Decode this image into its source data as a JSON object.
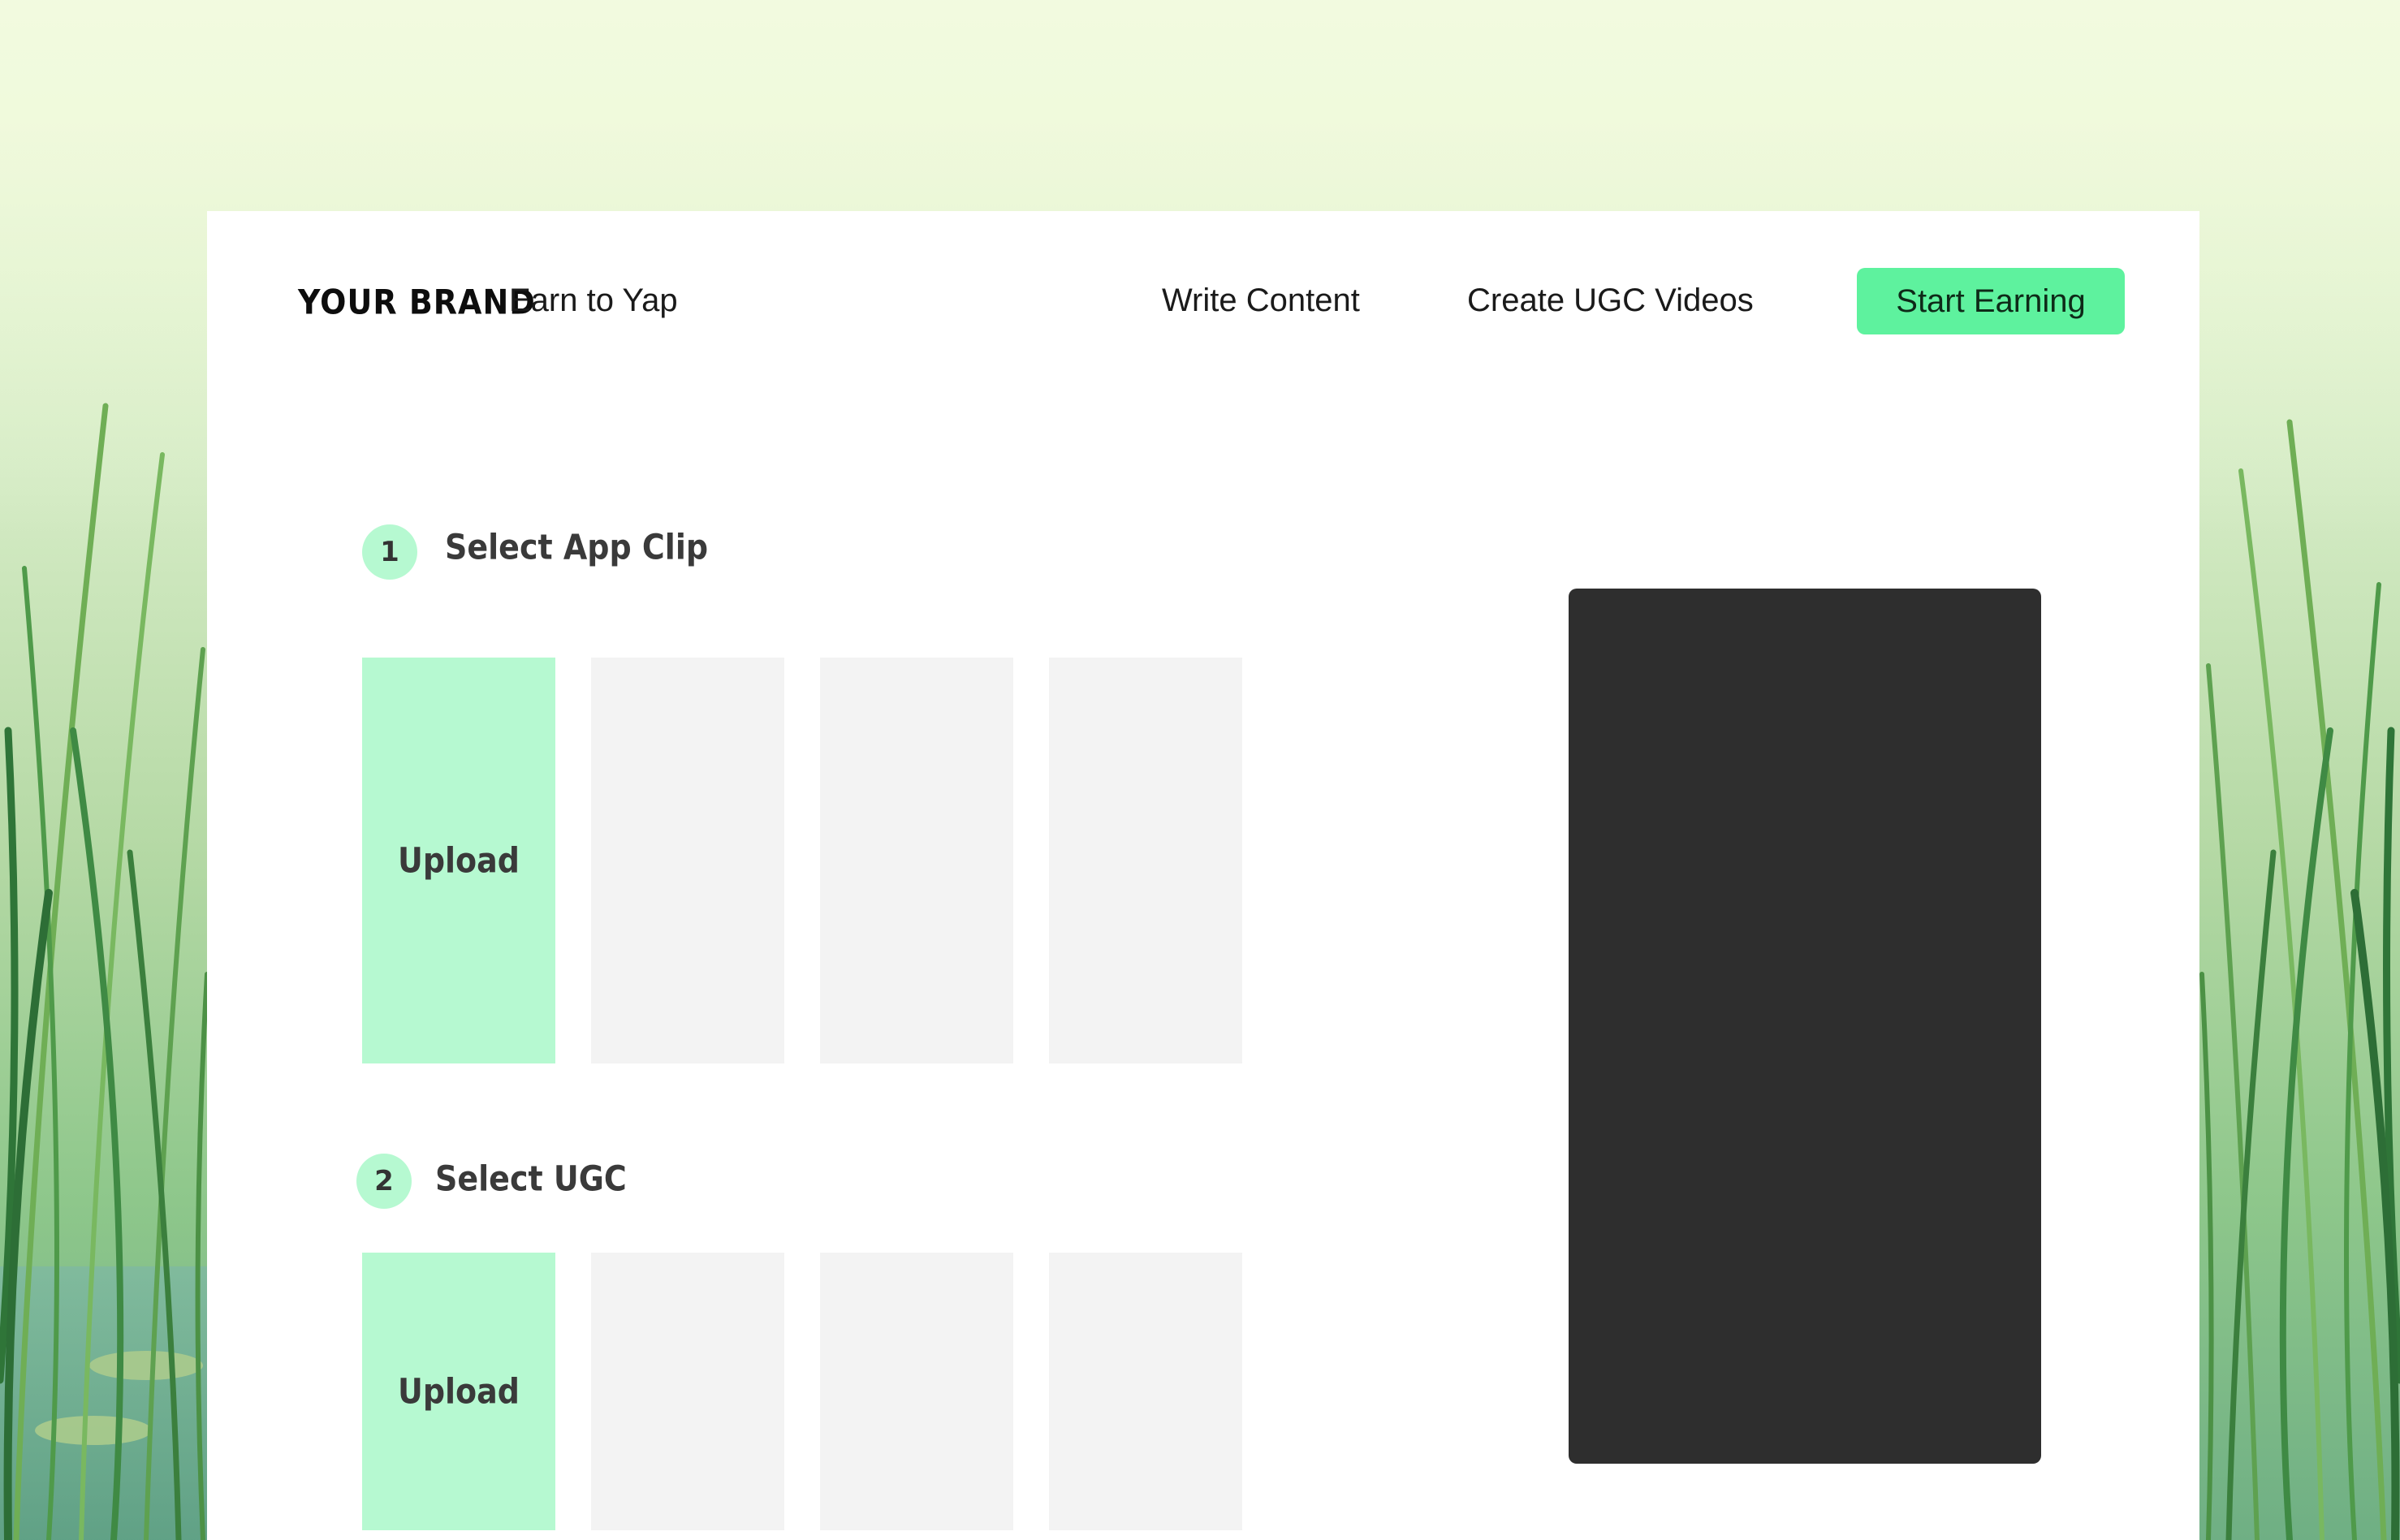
{
  "colors": {
    "accent": "#5ef29e",
    "tile_accent": "#b6f9d1",
    "tile_placeholder": "#f3f3f3",
    "preview_bg": "#2e2e2e",
    "card_bg": "#ffffff"
  },
  "header": {
    "brand": "YOUR BRAND",
    "tagline": "Earn to Yap",
    "nav": {
      "write_content": "Write Content",
      "create_ugc": "Create UGC Videos"
    },
    "cta_label": "Start Earning"
  },
  "steps": {
    "app_clip": {
      "number": "1",
      "title": "Select App Clip",
      "upload_label": "Upload"
    },
    "ugc": {
      "number": "2",
      "title": "Select UGC",
      "upload_label": "Upload"
    }
  }
}
